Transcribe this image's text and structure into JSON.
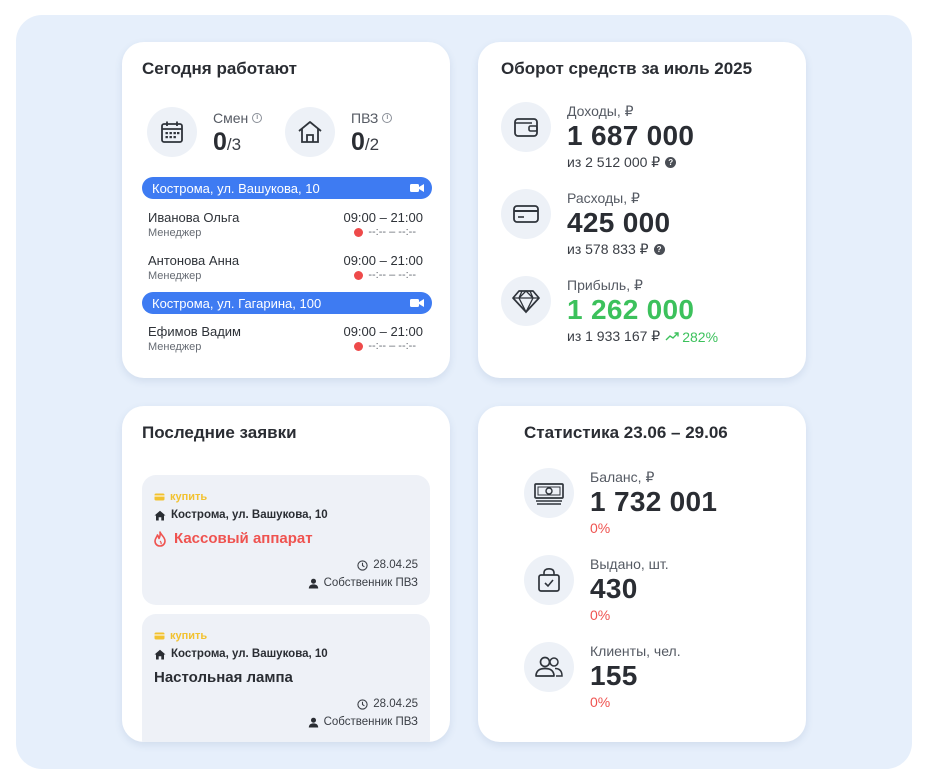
{
  "today": {
    "title": "Сегодня работают",
    "shifts": {
      "label": "Смен",
      "value": "0",
      "total": "/3",
      "icon": "calendar-icon"
    },
    "pvz": {
      "label": "ПВЗ",
      "value": "0",
      "total": "/2",
      "icon": "home-icon"
    },
    "locations": [
      {
        "name": "Кострома, ул. Вашукова, 10",
        "employees": [
          {
            "name": "Иванова Ольга",
            "role": "Менеджер",
            "time": "09:00 – 21:00",
            "checkin": "--:-- – --:--"
          },
          {
            "name": "Антонова Анна",
            "role": "Менеджер",
            "time": "09:00 – 21:00",
            "checkin": "--:-- – --:--"
          }
        ]
      },
      {
        "name": "Кострома, ул. Гагарина, 100",
        "employees": [
          {
            "name": "Ефимов Вадим",
            "role": "Менеджер",
            "time": "09:00 – 21:00",
            "checkin": "--:-- – --:--"
          }
        ]
      }
    ]
  },
  "turnover": {
    "title": "Оборот средств за июль 2025",
    "income": {
      "label": "Доходы, ₽",
      "value": "1 687 000",
      "sub": "из 2 512 000 ₽"
    },
    "expenses": {
      "label": "Расходы, ₽",
      "value": "425 000",
      "sub": "из 578 833 ₽"
    },
    "profit": {
      "label": "Прибыль, ₽",
      "value": "1 262 000",
      "sub": "из 1 933 167 ₽",
      "trend": "282%"
    }
  },
  "requests": {
    "title": "Последние заявки",
    "items": [
      {
        "tag": "купить",
        "address": "Кострома, ул. Вашукова, 10",
        "item": "Кассовый аппарат",
        "urgent": true,
        "date": "28.04.25",
        "owner": "Собственник ПВЗ"
      },
      {
        "tag": "купить",
        "address": "Кострома, ул. Вашукова, 10",
        "item": "Настольная лампа",
        "urgent": false,
        "date": "28.04.25",
        "owner": "Собственник ПВЗ"
      }
    ]
  },
  "stats": {
    "title": "Статистика 23.06 – 29.06",
    "balance": {
      "label": "Баланс, ₽",
      "value": "1 732 001",
      "pct": "0%"
    },
    "issued": {
      "label": "Выдано, шт.",
      "value": "430",
      "pct": "0%"
    },
    "clients": {
      "label": "Клиенты, чел.",
      "value": "155",
      "pct": "0%"
    }
  },
  "colors": {
    "accent": "#3e7bf2",
    "positive": "#3cc15c",
    "negative": "#ef5350",
    "tag": "#f2c230",
    "background": "#e6effb"
  }
}
